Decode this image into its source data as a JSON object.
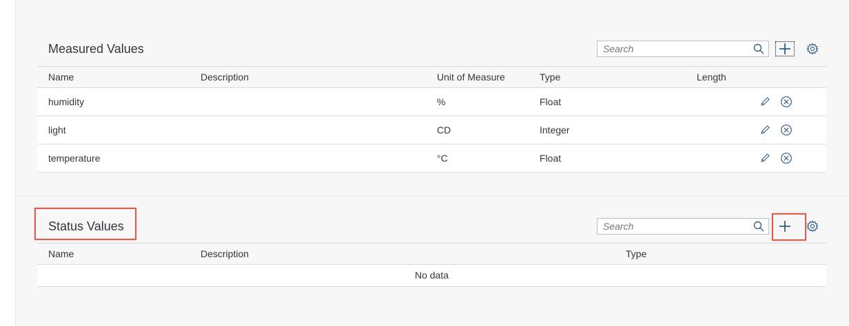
{
  "measured": {
    "title": "Measured Values",
    "search_placeholder": "Search",
    "columns": {
      "name": "Name",
      "description": "Description",
      "unit": "Unit of Measure",
      "type": "Type",
      "length": "Length"
    },
    "rows": [
      {
        "name": "humidity",
        "description": "",
        "unit": "%",
        "type": "Float",
        "length": ""
      },
      {
        "name": "light",
        "description": "",
        "unit": "CD",
        "type": "Integer",
        "length": ""
      },
      {
        "name": "temperature",
        "description": "",
        "unit": "°C",
        "type": "Float",
        "length": ""
      }
    ]
  },
  "status": {
    "title": "Status Values",
    "search_placeholder": "Search",
    "columns": {
      "name": "Name",
      "description": "Description",
      "type": "Type"
    },
    "no_data": "No data"
  },
  "icons": {
    "search": "magnifier-icon",
    "add": "plus-icon",
    "settings": "gear-icon",
    "edit": "pencil-icon",
    "delete": "circle-x-icon"
  },
  "colors": {
    "accent": "#0a6ed1",
    "icon": "#346187",
    "highlight": "#e35d4f"
  }
}
